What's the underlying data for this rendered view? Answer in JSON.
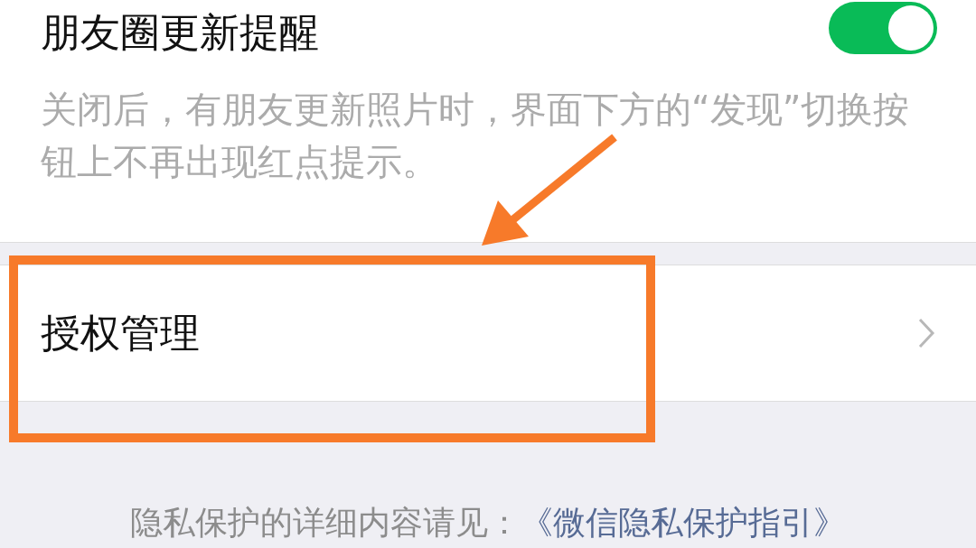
{
  "moments_update_reminder": {
    "label": "朋友圈更新提醒",
    "on": true,
    "description": "关闭后，有朋友更新照片时，界面下方的“发现”切换按钮上不再出现红点提示。"
  },
  "authorization": {
    "label": "授权管理"
  },
  "footer": {
    "text": "隐私保护的详细内容请见：",
    "link": "《微信隐私保护指引》"
  }
}
